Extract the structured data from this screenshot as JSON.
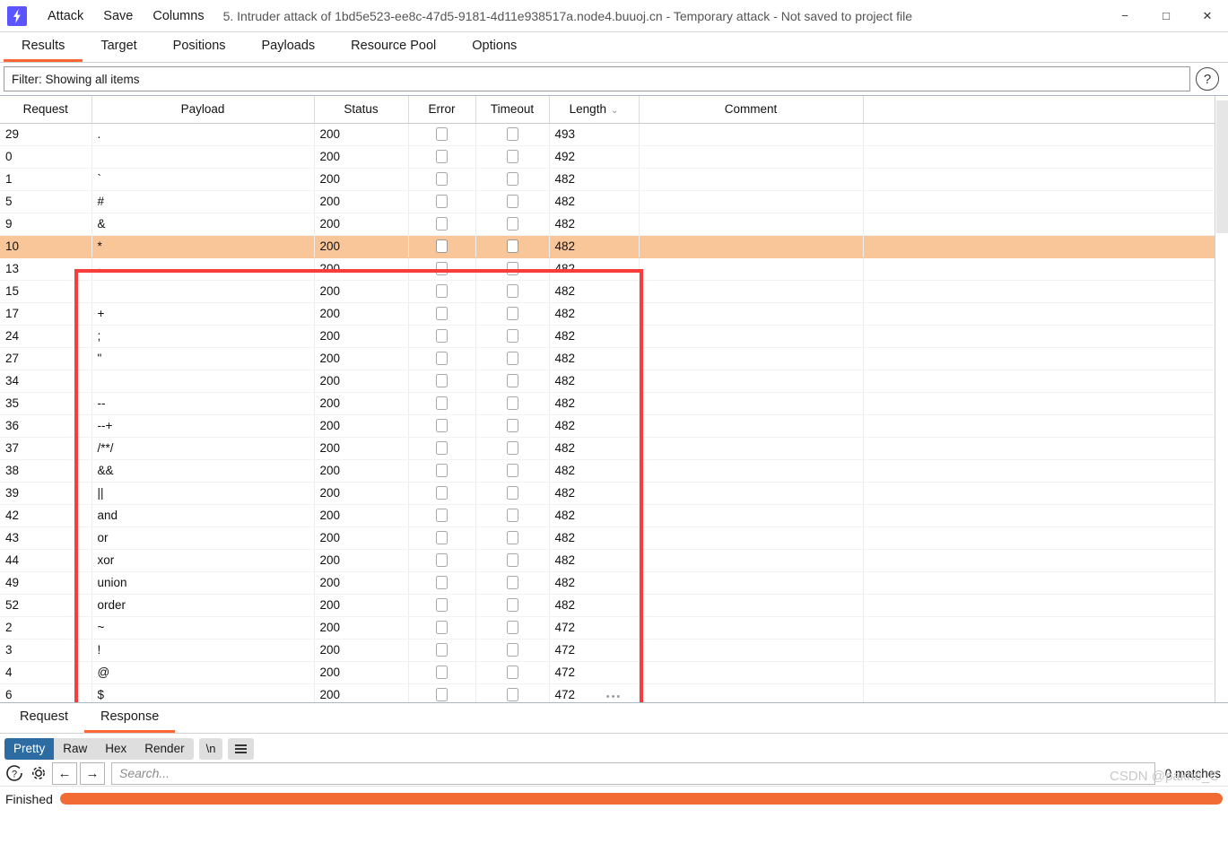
{
  "window": {
    "logo_icon": "burp-lightning-icon",
    "title": "5. Intruder attack of 1bd5e523-ee8c-47d5-9181-4d11e938517a.node4.buuoj.cn - Temporary attack - Not saved to project file",
    "menus": [
      "Attack",
      "Save",
      "Columns"
    ],
    "controls": {
      "minimize": "−",
      "maximize": "□",
      "close": "✕"
    }
  },
  "tabs": [
    {
      "label": "Results",
      "active": true
    },
    {
      "label": "Target",
      "active": false
    },
    {
      "label": "Positions",
      "active": false
    },
    {
      "label": "Payloads",
      "active": false
    },
    {
      "label": "Resource Pool",
      "active": false
    },
    {
      "label": "Options",
      "active": false
    }
  ],
  "filter": {
    "text": "Filter: Showing all items",
    "help_icon": "question-mark-icon"
  },
  "table": {
    "columns": [
      "Request",
      "Payload",
      "Status",
      "Error",
      "Timeout",
      "Length",
      "Comment"
    ],
    "sorted_column": "Length",
    "sort_glyph": "⌄",
    "rows": [
      {
        "request": "29",
        "payload": ".",
        "status": "200",
        "error": false,
        "timeout": false,
        "length": "493",
        "comment": "",
        "selected": false
      },
      {
        "request": "0",
        "payload": "",
        "status": "200",
        "error": false,
        "timeout": false,
        "length": "492",
        "comment": "",
        "selected": false
      },
      {
        "request": "1",
        "payload": "`",
        "status": "200",
        "error": false,
        "timeout": false,
        "length": "482",
        "comment": "",
        "selected": false
      },
      {
        "request": "5",
        "payload": "#",
        "status": "200",
        "error": false,
        "timeout": false,
        "length": "482",
        "comment": "",
        "selected": false
      },
      {
        "request": "9",
        "payload": "&",
        "status": "200",
        "error": false,
        "timeout": false,
        "length": "482",
        "comment": "",
        "selected": false
      },
      {
        "request": "10",
        "payload": "*",
        "status": "200",
        "error": false,
        "timeout": false,
        "length": "482",
        "comment": "",
        "selected": true
      },
      {
        "request": "13",
        "payload": "-",
        "status": "200",
        "error": false,
        "timeout": false,
        "length": "482",
        "comment": "",
        "selected": false
      },
      {
        "request": "15",
        "payload": "",
        "status": "200",
        "error": false,
        "timeout": false,
        "length": "482",
        "comment": "",
        "selected": false
      },
      {
        "request": "17",
        "payload": "+",
        "status": "200",
        "error": false,
        "timeout": false,
        "length": "482",
        "comment": "",
        "selected": false
      },
      {
        "request": "24",
        "payload": ";",
        "status": "200",
        "error": false,
        "timeout": false,
        "length": "482",
        "comment": "",
        "selected": false
      },
      {
        "request": "27",
        "payload": "\"",
        "status": "200",
        "error": false,
        "timeout": false,
        "length": "482",
        "comment": "",
        "selected": false
      },
      {
        "request": "34",
        "payload": "",
        "status": "200",
        "error": false,
        "timeout": false,
        "length": "482",
        "comment": "",
        "selected": false
      },
      {
        "request": "35",
        "payload": "--",
        "status": "200",
        "error": false,
        "timeout": false,
        "length": "482",
        "comment": "",
        "selected": false
      },
      {
        "request": "36",
        "payload": "--+",
        "status": "200",
        "error": false,
        "timeout": false,
        "length": "482",
        "comment": "",
        "selected": false
      },
      {
        "request": "37",
        "payload": "/**/",
        "status": "200",
        "error": false,
        "timeout": false,
        "length": "482",
        "comment": "",
        "selected": false
      },
      {
        "request": "38",
        "payload": "&&",
        "status": "200",
        "error": false,
        "timeout": false,
        "length": "482",
        "comment": "",
        "selected": false
      },
      {
        "request": "39",
        "payload": "||",
        "status": "200",
        "error": false,
        "timeout": false,
        "length": "482",
        "comment": "",
        "selected": false
      },
      {
        "request": "42",
        "payload": "and",
        "status": "200",
        "error": false,
        "timeout": false,
        "length": "482",
        "comment": "",
        "selected": false
      },
      {
        "request": "43",
        "payload": "or",
        "status": "200",
        "error": false,
        "timeout": false,
        "length": "482",
        "comment": "",
        "selected": false
      },
      {
        "request": "44",
        "payload": "xor",
        "status": "200",
        "error": false,
        "timeout": false,
        "length": "482",
        "comment": "",
        "selected": false
      },
      {
        "request": "49",
        "payload": "union",
        "status": "200",
        "error": false,
        "timeout": false,
        "length": "482",
        "comment": "",
        "selected": false
      },
      {
        "request": "52",
        "payload": "order",
        "status": "200",
        "error": false,
        "timeout": false,
        "length": "482",
        "comment": "",
        "selected": false
      },
      {
        "request": "2",
        "payload": "~",
        "status": "200",
        "error": false,
        "timeout": false,
        "length": "472",
        "comment": "",
        "selected": false
      },
      {
        "request": "3",
        "payload": "!",
        "status": "200",
        "error": false,
        "timeout": false,
        "length": "472",
        "comment": "",
        "selected": false
      },
      {
        "request": "4",
        "payload": "@",
        "status": "200",
        "error": false,
        "timeout": false,
        "length": "472",
        "comment": "",
        "selected": false
      },
      {
        "request": "6",
        "payload": "$",
        "status": "200",
        "error": false,
        "timeout": false,
        "length": "472",
        "comment": "",
        "selected": false
      }
    ]
  },
  "annotation": {
    "color": "#f93c3c",
    "shape": "rectangle"
  },
  "detail": {
    "tabs": [
      {
        "label": "Request",
        "active": false
      },
      {
        "label": "Response",
        "active": true
      }
    ],
    "view_modes": [
      {
        "label": "Pretty",
        "active": true
      },
      {
        "label": "Raw",
        "active": false
      },
      {
        "label": "Hex",
        "active": false
      },
      {
        "label": "Render",
        "active": false
      }
    ],
    "newline_button": "\\n",
    "menu_icon": "hamburger-icon",
    "help_icon": "question-mark-icon",
    "settings_icon": "gear-icon",
    "back_icon": "arrow-left-icon",
    "forward_icon": "arrow-right-icon",
    "search_placeholder": "Search...",
    "search_value": "",
    "matches": "0 matches"
  },
  "status": {
    "label": "Finished",
    "progress_percent": 100,
    "progress_color": "#f26b35"
  },
  "watermark": "CSDN @pakho_C"
}
